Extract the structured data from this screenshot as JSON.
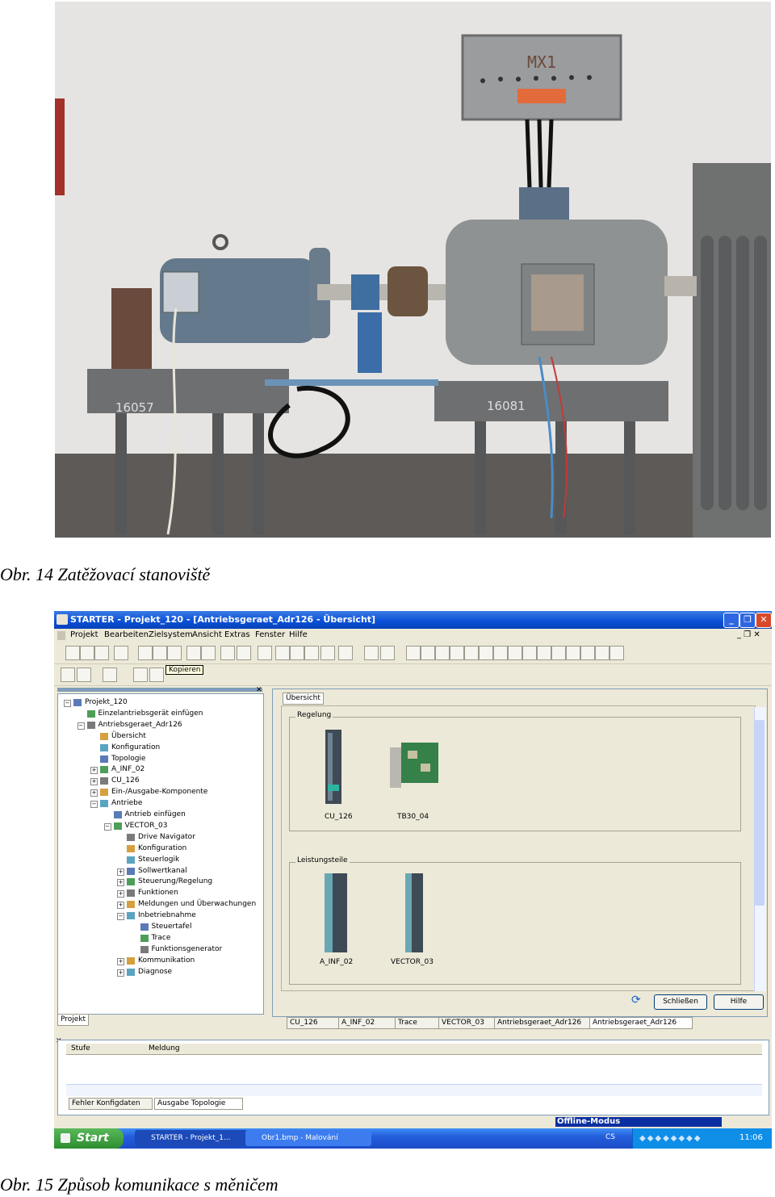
{
  "captions": {
    "photo": "Obr. 14 Zatěžovací stanoviště",
    "screenshot": "Obr. 15 Způsob komunikace s měničem"
  },
  "photo_labels": {
    "box": "MX1",
    "left_table": "16057",
    "right_table": "16081"
  },
  "app": {
    "title": "STARTER - Projekt_120 - [Antriebsgeraet_Adr126 - Übersicht]",
    "menu": [
      "Projekt",
      "Bearbeiten",
      "Zielsystem",
      "Ansicht",
      "Extras",
      "Fenster",
      "Hilfe"
    ],
    "tooltip": "Kopieren",
    "tree": [
      {
        "label": "Projekt_120",
        "level": 0,
        "pm": "-"
      },
      {
        "label": "Einzelantriebsgerät einfügen",
        "level": 1,
        "pm": ""
      },
      {
        "label": "Antriebsgeraet_Adr126",
        "level": 1,
        "pm": "-"
      },
      {
        "label": "Übersicht",
        "level": 2,
        "pm": ""
      },
      {
        "label": "Konfiguration",
        "level": 2,
        "pm": ""
      },
      {
        "label": "Topologie",
        "level": 2,
        "pm": ""
      },
      {
        "label": "A_INF_02",
        "level": 2,
        "pm": "+"
      },
      {
        "label": "CU_126",
        "level": 2,
        "pm": "+"
      },
      {
        "label": "Ein-/Ausgabe-Komponente",
        "level": 2,
        "pm": "+"
      },
      {
        "label": "Antriebe",
        "level": 2,
        "pm": "-"
      },
      {
        "label": "Antrieb einfügen",
        "level": 3,
        "pm": ""
      },
      {
        "label": "VECTOR_03",
        "level": 3,
        "pm": "-"
      },
      {
        "label": "Drive Navigator",
        "level": 4,
        "pm": ""
      },
      {
        "label": "Konfiguration",
        "level": 4,
        "pm": ""
      },
      {
        "label": "Steuerlogik",
        "level": 4,
        "pm": ""
      },
      {
        "label": "Sollwertkanal",
        "level": 4,
        "pm": "+"
      },
      {
        "label": "Steuerung/Regelung",
        "level": 4,
        "pm": "+"
      },
      {
        "label": "Funktionen",
        "level": 4,
        "pm": "+"
      },
      {
        "label": "Meldungen und Überwachungen",
        "level": 4,
        "pm": "+"
      },
      {
        "label": "Inbetriebnahme",
        "level": 4,
        "pm": "-"
      },
      {
        "label": "Steuertafel",
        "level": 5,
        "pm": ""
      },
      {
        "label": "Trace",
        "level": 5,
        "pm": ""
      },
      {
        "label": "Funktionsgenerator",
        "level": 5,
        "pm": ""
      },
      {
        "label": "Kommunikation",
        "level": 4,
        "pm": "+"
      },
      {
        "label": "Diagnose",
        "level": 4,
        "pm": "+"
      }
    ],
    "right_tab": "Übersicht",
    "group_regelung": "Regelung",
    "group_leistung": "Leistungsteile",
    "units_regelung": [
      "CU_126",
      "TB30_04"
    ],
    "units_leistung": [
      "A_INF_02",
      "VECTOR_03"
    ],
    "btn_close": "Schließen",
    "btn_help": "Hilfe",
    "left_tab": "Projekt",
    "window_tabs": [
      "CU_126",
      "A_INF_02",
      "Trace",
      "VECTOR_03",
      "Antriebsgeraet_Adr126",
      "Antriebsgeraet_Adr126"
    ],
    "msg_cols": [
      "Stufe",
      "Meldung"
    ],
    "bottom_tabs": [
      "Fehler Konfigdaten",
      "Ausgabe Topologie"
    ],
    "status": "Offline-Modus",
    "taskbar": {
      "start": "Start",
      "tasks": [
        "STARTER - Projekt_1...",
        "Obr1.bmp - Malování"
      ],
      "lang": "CS",
      "clock": "11:06"
    }
  }
}
